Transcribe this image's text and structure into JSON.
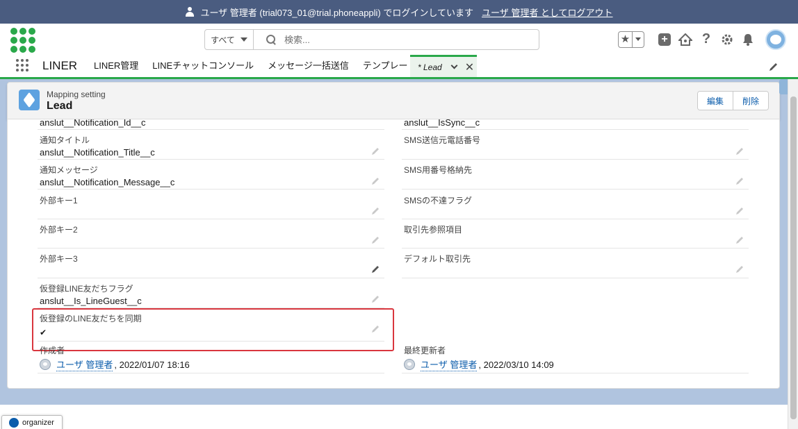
{
  "banner": {
    "login_text": "ユーザ 管理者 (trial073_01@trial.phoneappli) でログインしています",
    "logout_link": "ユーザ 管理者 としてログアウト"
  },
  "search": {
    "scope": "すべて",
    "placeholder": "検索..."
  },
  "nav": {
    "app_name": "LINER",
    "items": [
      {
        "label": "LINER管理"
      },
      {
        "label": "LINEチャットコンソール"
      },
      {
        "label": "メッセージ一括送信"
      },
      {
        "label": "テンプレート管理"
      }
    ],
    "active_tab": "* Lead"
  },
  "record": {
    "object_label": "Mapping setting",
    "title": "Lead",
    "edit_button": "編集",
    "delete_button": "削除"
  },
  "fields_left": [
    {
      "label": "",
      "value": "anslut__Notification_Id__c"
    },
    {
      "label": "通知タイトル",
      "value": "anslut__Notification_Title__c"
    },
    {
      "label": "通知メッセージ",
      "value": "anslut__Notification_Message__c"
    },
    {
      "label": "外部キー1",
      "value": ""
    },
    {
      "label": "外部キー2",
      "value": ""
    },
    {
      "label": "外部キー3",
      "value": ""
    },
    {
      "label": "仮登録LINE友だちフラグ",
      "value": "anslut__Is_LineGuest__c"
    },
    {
      "label": "仮登録のLINE友だちを同期",
      "value": "✔"
    }
  ],
  "fields_right": [
    {
      "label": "",
      "value": "anslut__IsSync__c"
    },
    {
      "label": "SMS送信元電話番号",
      "value": ""
    },
    {
      "label": "SMS用番号格納先",
      "value": ""
    },
    {
      "label": "SMSの不達フラグ",
      "value": ""
    },
    {
      "label": "取引先参照項目",
      "value": ""
    },
    {
      "label": "デフォルト取引先",
      "value": ""
    }
  ],
  "created": {
    "label": "作成者",
    "user": "ユーザ 管理者",
    "date": ", 2022/01/07 18:16"
  },
  "modified": {
    "label": "最終更新者",
    "user": "ユーザ 管理者",
    "date": ", 2022/03/10 14:09"
  },
  "bottom": {
    "section_text": "ation",
    "organizer": "organizer"
  }
}
